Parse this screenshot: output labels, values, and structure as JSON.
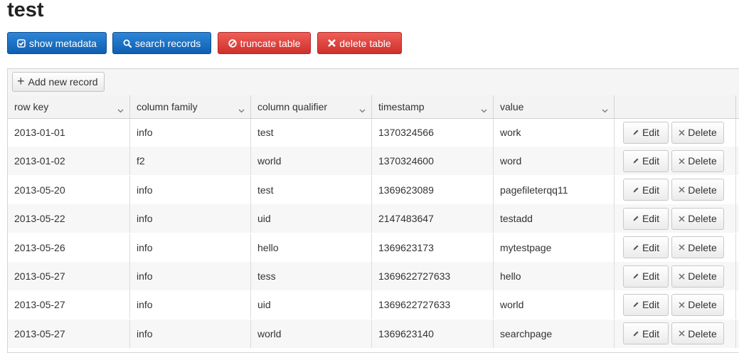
{
  "page": {
    "title": "test"
  },
  "toolbar": {
    "buttons": [
      {
        "label": "show metadata",
        "icon": "check-square-icon",
        "color": "#0e65c0"
      },
      {
        "label": "search records",
        "icon": "search-icon",
        "color": "#0e65c0"
      },
      {
        "label": "truncate table",
        "icon": "ban-icon",
        "color": "#d9403b"
      },
      {
        "label": "delete table",
        "icon": "close-icon",
        "color": "#d9403b"
      }
    ]
  },
  "grid": {
    "add_label": "Add new record",
    "columns": [
      "row key",
      "column family",
      "column qualifier",
      "timestamp",
      "value",
      ""
    ],
    "edit_label": "Edit",
    "delete_label": "Delete",
    "rows": [
      [
        "2013-01-01",
        "info",
        "test",
        "1370324566",
        "work"
      ],
      [
        "2013-01-02",
        "f2",
        "world",
        "1370324600",
        "word"
      ],
      [
        "2013-05-20",
        "info",
        "test",
        "1369623089",
        "pagefileterqq11"
      ],
      [
        "2013-05-22",
        "info",
        "uid",
        "2147483647",
        "testadd"
      ],
      [
        "2013-05-26",
        "info",
        "hello",
        "1369623173",
        "mytestpage"
      ],
      [
        "2013-05-27",
        "info",
        "tess",
        "1369622727633",
        "hello"
      ],
      [
        "2013-05-27",
        "info",
        "uid",
        "1369622727633",
        "world"
      ],
      [
        "2013-05-27",
        "info",
        "world",
        "1369623140",
        "searchpage"
      ]
    ]
  }
}
